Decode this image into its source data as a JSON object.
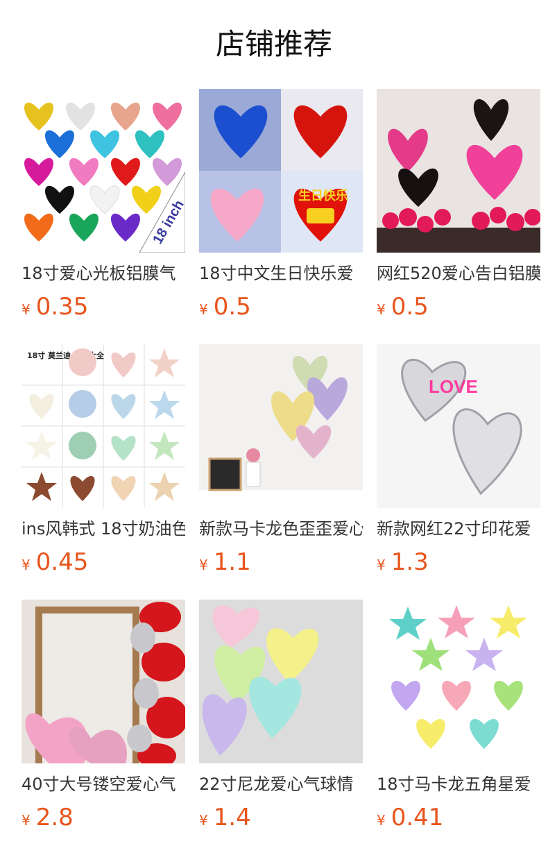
{
  "page": {
    "title": "店铺推荐"
  },
  "currency_symbol": "¥",
  "products": [
    {
      "name": "18寸爱心光板铝膜气",
      "price": "0.35",
      "thumb_badge": "18 inch"
    },
    {
      "name": "18寸中文生日快乐爱",
      "price": "0.5",
      "thumb_badge": "生日快乐"
    },
    {
      "name": "网红520爱心告白铝膜",
      "price": "0.5"
    },
    {
      "name": "ins风韩式 18寸奶油色",
      "price": "0.45",
      "thumb_badge": "18寸 莫兰迪 气球大全"
    },
    {
      "name": "新款马卡龙色歪歪爱心",
      "price": "1.1"
    },
    {
      "name": "新款网红22寸印花爱",
      "price": "1.3",
      "thumb_badge": "LOVE"
    },
    {
      "name": "40寸大号镂空爱心气",
      "price": "2.8"
    },
    {
      "name": "22寸尼龙爱心气球情",
      "price": "1.4"
    },
    {
      "name": "18寸马卡龙五角星爱",
      "price": "0.41"
    }
  ],
  "colors": {
    "price": "#e8541b",
    "title": "#111111",
    "name": "#333333"
  }
}
